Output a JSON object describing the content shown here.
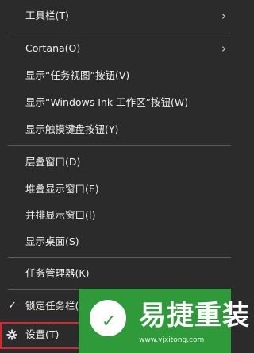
{
  "menu": {
    "items": [
      {
        "label": "工具栏(T)",
        "has_submenu": true
      },
      {
        "label": "Cortana(O)",
        "has_submenu": true
      },
      {
        "label": "显示“任务视图”按钮(V)"
      },
      {
        "label": "显示“Windows Ink 工作区”按钮(W)"
      },
      {
        "label": "显示触摸键盘按钮(Y)"
      },
      {
        "label": "层叠窗口(D)"
      },
      {
        "label": "堆叠显示窗口(E)"
      },
      {
        "label": "并排显示窗口(I)"
      },
      {
        "label": "显示桌面(S)"
      },
      {
        "label": "任务管理器(K)"
      },
      {
        "label": "锁定任务栏(L)",
        "checked": true
      },
      {
        "label": "设置(T)",
        "icon": "gear-icon",
        "highlighted": true
      }
    ],
    "submenu_arrow": "›",
    "check_glyph": "✓"
  },
  "watermark": {
    "brand": "易捷重装",
    "url": "www.yjxitong.com"
  },
  "colors": {
    "background": "#2b2b2b",
    "text": "#f0f0f0",
    "separator": "#5a5a5a",
    "highlight_border": "#e0232b",
    "logo_green": "#2f9a3a"
  }
}
